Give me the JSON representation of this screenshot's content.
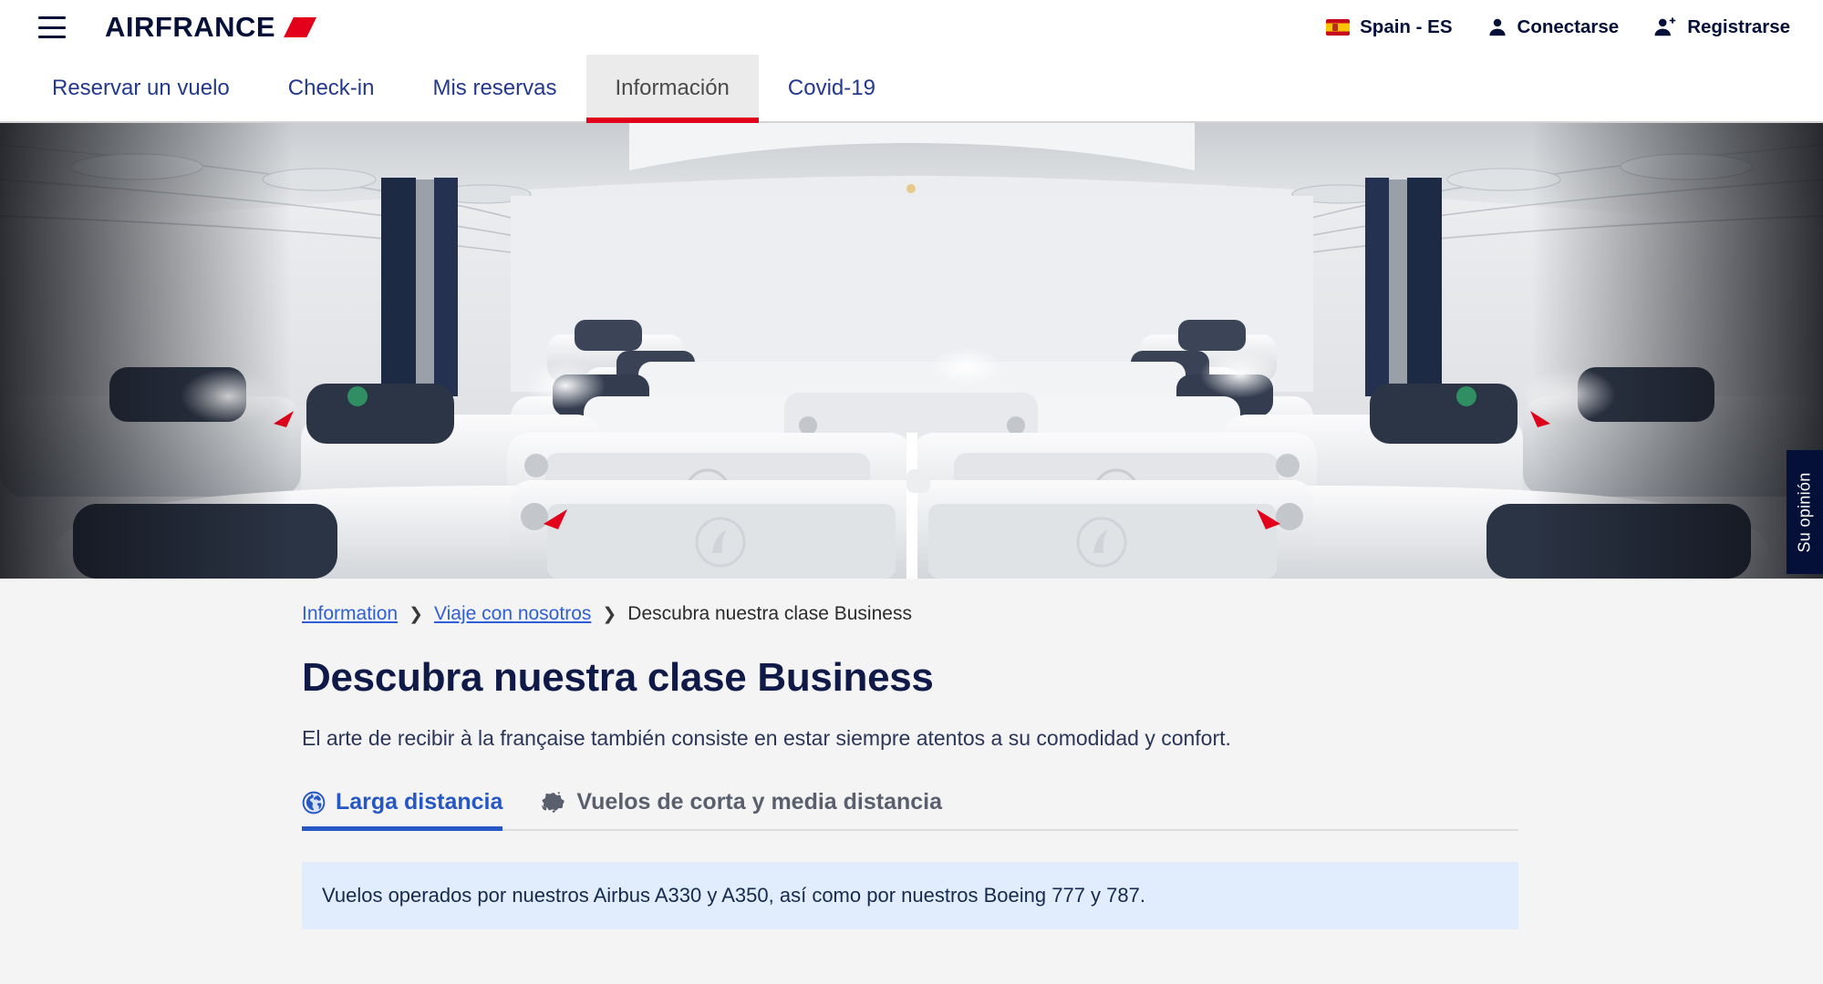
{
  "header": {
    "menu_icon": "hamburger-menu-icon",
    "brand": "AIRFRANCE",
    "right_items": [
      {
        "icon": "spain-flag-icon",
        "label": "Spain - ES"
      },
      {
        "icon": "person-icon",
        "label": "Conectarse"
      },
      {
        "icon": "person-plus-icon",
        "label": "Registrarse"
      }
    ]
  },
  "main_nav": {
    "items": [
      {
        "label": "Reservar un vuelo",
        "active": false
      },
      {
        "label": "Check-in",
        "active": false
      },
      {
        "label": "Mis reservas",
        "active": false
      },
      {
        "label": "Información",
        "active": true
      },
      {
        "label": "Covid-19",
        "active": false
      }
    ],
    "active_underline_color": "#e2001a"
  },
  "hero": {
    "alt": "Air France business class cabin interior with white seat shells and navy headrests"
  },
  "feedback_tab": {
    "label": "Su opinión",
    "background": "#051039"
  },
  "breadcrumb": {
    "items": [
      {
        "label": "Information ",
        "type": "link"
      },
      {
        "label": " Viaje con nosotros ",
        "type": "link"
      },
      {
        "label": "Descubra nuestra clase Business",
        "type": "current"
      }
    ],
    "separator": "❯"
  },
  "page": {
    "title": "Descubra nuestra clase Business",
    "subtitle": "El arte de recibir à la française también consiste en estar siempre atentos a su comodidad y confort."
  },
  "subtabs": [
    {
      "label": "Larga distancia",
      "icon": "globe-icon",
      "active": true
    },
    {
      "label": "Vuelos de corta y media distancia",
      "icon": "europe-map-icon",
      "active": false
    }
  ],
  "info_banner": {
    "text": "Vuelos operados por nuestros Airbus A330 y A350, así como por nuestros Boeing 777 y 787.",
    "background": "#e1edfd"
  },
  "colors": {
    "brand_navy": "#051039",
    "brand_red": "#e2001a",
    "link_blue": "#2f5fd7",
    "accent_blue": "#2657c4",
    "content_bg": "#f4f4f4"
  }
}
